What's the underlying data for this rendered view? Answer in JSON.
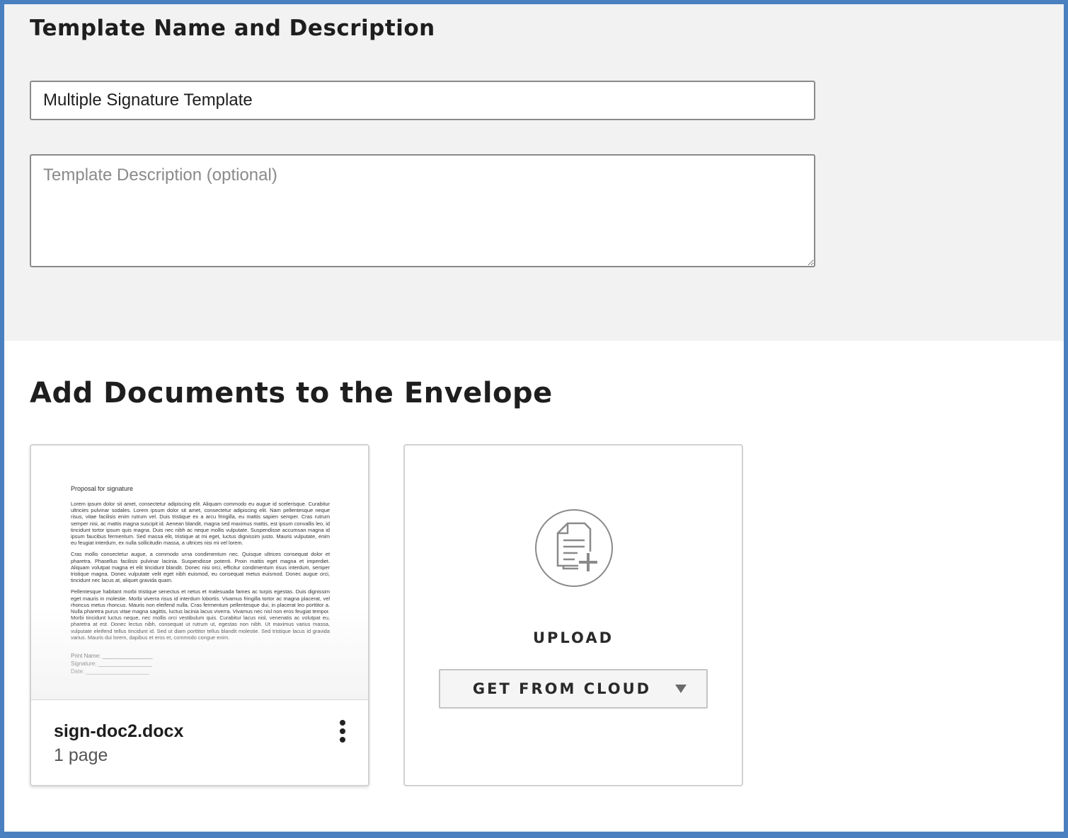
{
  "template_section": {
    "title": "Template Name and Description",
    "name_value": "Multiple Signature Template",
    "description_value": "",
    "description_placeholder": "Template Description (optional)"
  },
  "documents_section": {
    "title": "Add Documents to the Envelope",
    "document": {
      "filename": "sign-doc2.docx",
      "page_count": "1 page",
      "preview": {
        "heading": "Proposal for signature",
        "paragraphs": [
          "Lorem ipsum dolor sit amet, consectetur adipiscing elit. Aliquam commodo eu augue id scelerisque. Curabitur ultricies pulvinar sodales. Lorem ipsum dolor sit amet, consectetur adipiscing elit. Nam pellentesque neque risus, vitae facilisis enim rutrum vel. Duis tristique ex a arcu fringilla, eu mattis sapien semper. Cras rutrum semper nisi, ac mattis magna suscipit id. Aenean blandit, magna sed maximus mattis, est ipsum convallis leo, id tincidunt tortor ipsum quis magna. Duis nec nibh ac neque mollis vulputate. Suspendisse accumsan magna id ipsum faucibus fermentum. Sed massa elit, tristique at mi eget, luctus dignissim justo. Mauris vulputate, enim eu feugiat interdum, ex nulla sollicitudin massa, a ultrices nisi mi vel lorem.",
          "Cras mollis consectetur augue, a commodo urna condimentum nec. Quisque ultrices consequat dolor et pharetra. Phasellus facilisis pulvinar lacinia. Suspendisse potenti. Proin mattis eget magna et imperdiet. Aliquam volutpat magna et elit tincidunt blandit. Donec nisi orci, efficitur condimentum risus interdum, semper tristique magna. Donec vulputate velit eget nibh euismod, eu consequat metus euismod. Donec augue orci, tincidunt nec lacus at, aliquet gravida quam.",
          "Pellentesque habitant morbi tristique senectus et netus et malesuada fames ac turpis egestas. Duis dignissim eget mauris in molestie. Morbi viverra risus id interdum lobortis. Vivamus fringilla tortor ac magna placerat, vel rhoncus metus rhoncus. Mauris non eleifend nulla. Cras fermentum pellentesque dui, in placerat leo porttitor a. Nulla pharetra purus vitae magna sagittis, luctus lacinia lacus viverra. Vivamus nec nisl non eros feugiat tempor. Morbi tincidunt luctus neque, nec mollis orci vestibulum quis. Curabitur lacus nisl, venenatis ac volutpat eu, pharetra at est. Donec lectus nibh, consequat ut rutrum ut, egestas non nibh. Ut maximus varius massa, vulputate eleifend tellus tincidunt id. Sed ut diam porttitor tellus blandit molestie. Sed tristique lacus id gravida varius. Mauris dui lorem, dapibus et eros et, commodo congue enim."
        ],
        "print_name_line": "Print Name: ________________",
        "signature_line": "Signature: _________________",
        "date_line": "Date: ____________________"
      }
    },
    "upload": {
      "icon": "document-add-icon",
      "label": "UPLOAD",
      "cloud_button_label": "GET FROM CLOUD",
      "cloud_button_icon": "caret-down-icon"
    }
  },
  "colors": {
    "frame_border": "#4a80c0",
    "top_section_bg": "#f2f2f2",
    "text_dark": "#1e1e1e",
    "input_border": "#8a8a8a"
  }
}
